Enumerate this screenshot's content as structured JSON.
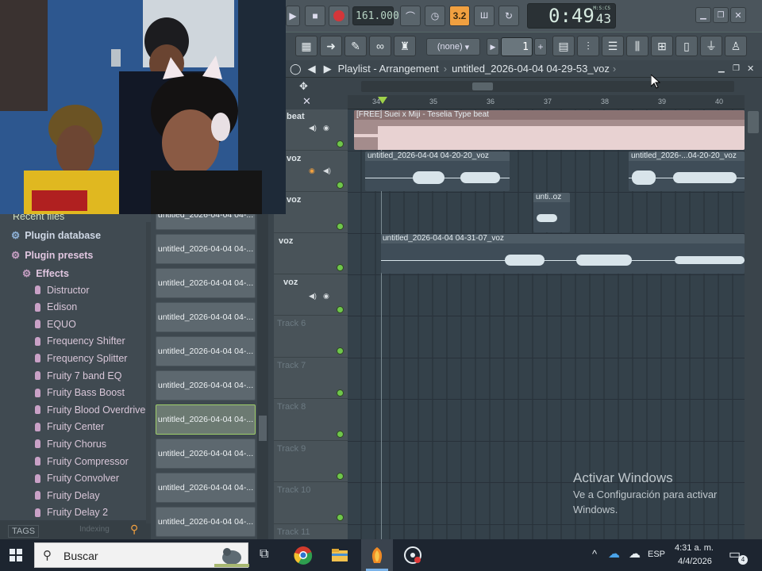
{
  "transport": {
    "tempo": "161.000",
    "time_main": "0:49",
    "time_sub": "43",
    "time_label": "M:S:CS",
    "pattern_label": "3.2",
    "snap": "(none)",
    "pattern_number": "1"
  },
  "playlist": {
    "title": "Playlist - Arrangement",
    "arrow": "›",
    "project": "untitled_2026-04-04 04-29-53_voz",
    "ruler_ticks": [
      "34",
      "35",
      "36",
      "37",
      "38",
      "39",
      "40"
    ]
  },
  "tracks": [
    {
      "name": "beat"
    },
    {
      "name": "voz"
    },
    {
      "name": "voz"
    },
    {
      "name": "voz"
    },
    {
      "name": "voz"
    },
    {
      "name": "Track 6"
    },
    {
      "name": "Track 7"
    },
    {
      "name": "Track 8"
    },
    {
      "name": "Track 9"
    },
    {
      "name": "Track 10"
    },
    {
      "name": "Track 11"
    }
  ],
  "clips": {
    "beat": "[FREE] Suei x Miji - Teselia Type beat",
    "voz1a": "untitled_2026-04-04 04-20-20_voz",
    "voz1b": "untitled_2026-...04-20-20_voz",
    "voz2": "unti..oz",
    "voz3": "untitled_2026-04-04 04-31-07_voz"
  },
  "browser": {
    "recent": "Recent files",
    "plugin_database": "Plugin database",
    "plugin_presets": "Plugin presets",
    "effects": "Effects",
    "items": [
      "Distructor",
      "Edison",
      "EQUO",
      "Frequency Shifter",
      "Frequency Splitter",
      "Fruity 7 band EQ",
      "Fruity Bass Boost",
      "Fruity Blood Overdrive",
      "Fruity Center",
      "Fruity Chorus",
      "Fruity Compressor",
      "Fruity Convolver",
      "Fruity Delay",
      "Fruity Delay 2"
    ],
    "tags": "TAGS",
    "indexing": "Indexing"
  },
  "files": [
    "untitled_2026-04-04 04-...",
    "untitled_2026-04-04 04-...",
    "untitled_2026-04-04 04-...",
    "untitled_2026-04-04 04-...",
    "untitled_2026-04-04 04-...",
    "untitled_2026-04-04 04-...",
    "untitled_2026-04-04 04-...",
    "untitled_2026-04-04 04-...",
    "untitled_2026-04-04 04-...",
    "untitled_2026-04-04 04-..."
  ],
  "watermark": {
    "title": "Activar Windows",
    "line1": "Ve a Configuración para activar",
    "line2": "Windows."
  },
  "taskbar": {
    "search_placeholder": "Buscar",
    "lang": "ESP",
    "time": "4:31 a. m.",
    "date": "4/4/2026",
    "notif_count": "4"
  },
  "colors": {
    "accent": "#f0a040",
    "led": "#6fc64b",
    "beat_clip": "#c8a9a9",
    "voz_clip": "#4a5a66"
  }
}
